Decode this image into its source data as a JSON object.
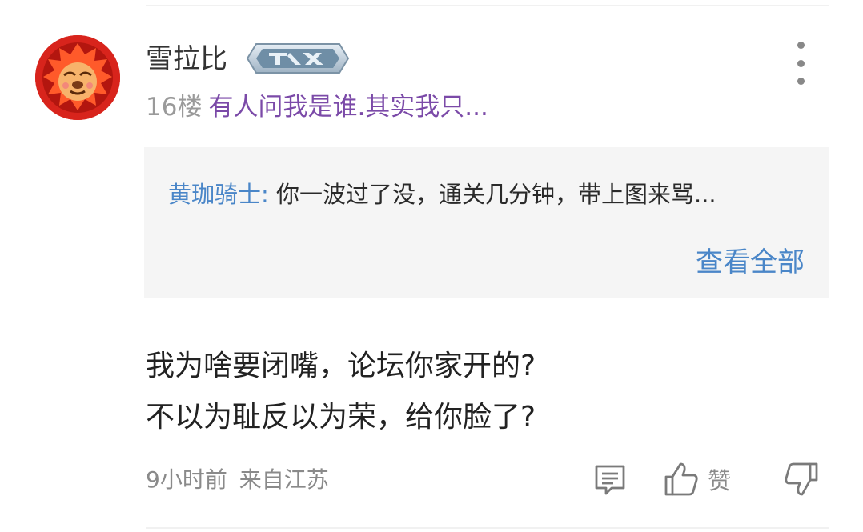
{
  "post": {
    "username": "雪拉比",
    "floor": "16楼",
    "signature": "有人问我是谁.其实我只...",
    "reply": {
      "author": "黄珈骑士:",
      "text": " 你一波过了没，通关几分钟，带上图来骂...",
      "view_all": "查看全部"
    },
    "body_lines": [
      "我为啥要闭嘴，论坛你家开的?",
      "不以为耻反以为荣，给你脸了?"
    ],
    "time": "9小时前",
    "location": "来自江苏",
    "like_label": "赞"
  },
  "colors": {
    "accent_blue": "#4a86c8",
    "signature_purple": "#7b4aa8",
    "avatar_red": "#d8241c"
  }
}
